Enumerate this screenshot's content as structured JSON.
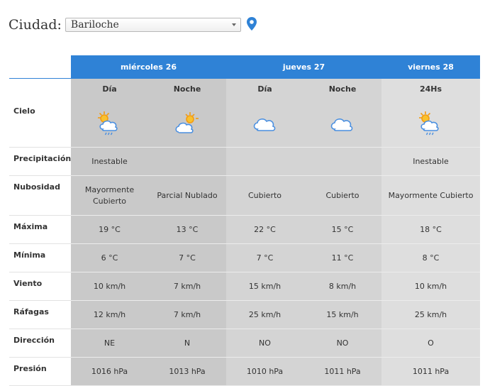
{
  "city": {
    "label": "Ciudad:",
    "selected": "Bariloche",
    "pin_icon": "location-pin-icon",
    "accent": "#2f82d6"
  },
  "days": [
    {
      "label": "miércoles 26"
    },
    {
      "label": "jueves 27"
    },
    {
      "label": "viernes 28"
    }
  ],
  "periods": [
    "Día",
    "Noche",
    "Día",
    "Noche",
    "24Hs"
  ],
  "rows": {
    "cielo": {
      "label": "Cielo",
      "icons": [
        "sun-cloud-rain-icon",
        "sun-cloud-icon",
        "cloud-icon",
        "cloud-icon",
        "sun-cloud-rain-icon"
      ]
    },
    "precipitacion": {
      "label": "Precipitación",
      "values": [
        "Inestable",
        "",
        "",
        "",
        "Inestable"
      ]
    },
    "nubosidad": {
      "label": "Nubosidad",
      "values": [
        "Mayormente Cubierto",
        "Parcial Nublado",
        "Cubierto",
        "Cubierto",
        "Mayormente Cubierto"
      ]
    },
    "maxima": {
      "label": "Máxima",
      "values": [
        "19 °C",
        "13 °C",
        "22 °C",
        "15 °C",
        "18 °C"
      ]
    },
    "minima": {
      "label": "Mínima",
      "values": [
        "6 °C",
        "7 °C",
        "7 °C",
        "11 °C",
        "8 °C"
      ]
    },
    "viento": {
      "label": "Viento",
      "values": [
        "10 km/h",
        "7 km/h",
        "15 km/h",
        "8 km/h",
        "10 km/h"
      ]
    },
    "rafagas": {
      "label": "Ráfagas",
      "values": [
        "12 km/h",
        "7 km/h",
        "25 km/h",
        "15 km/h",
        "25 km/h"
      ]
    },
    "direccion": {
      "label": "Dirección",
      "values": [
        "NE",
        "N",
        "NO",
        "NO",
        "O"
      ]
    },
    "presion": {
      "label": "Presión",
      "values": [
        "1016 hPa",
        "1013 hPa",
        "1010 hPa",
        "1011 hPa",
        "1011 hPa"
      ]
    }
  }
}
